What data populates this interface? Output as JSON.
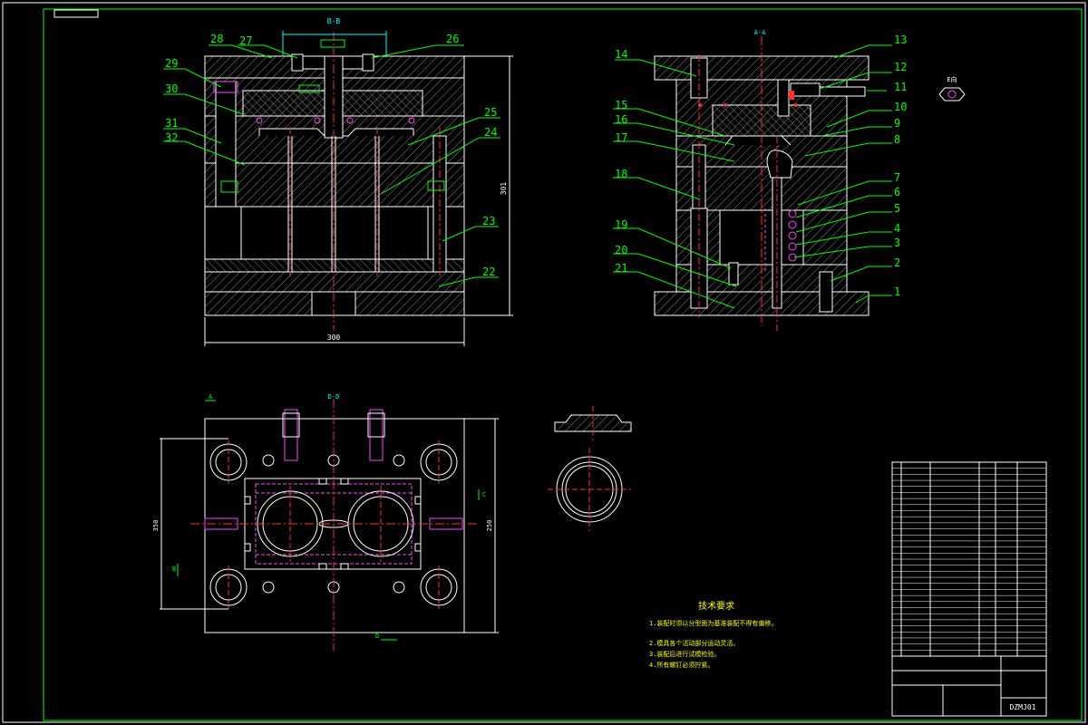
{
  "views": {
    "front_section_label": "B-B",
    "side_section_label": "A-A",
    "top_section_label": "D-D",
    "detail_label": "E向"
  },
  "part_numbers": {
    "left": [
      "28",
      "27",
      "26",
      "29",
      "30",
      "31",
      "32",
      "25",
      "24",
      "23",
      "22"
    ],
    "right": [
      "14",
      "13",
      "12",
      "11",
      "10",
      "9",
      "15",
      "16",
      "17",
      "8",
      "18",
      "7",
      "6",
      "5",
      "4",
      "3",
      "19",
      "20",
      "21",
      "2",
      "1"
    ]
  },
  "dimensions": {
    "front_width": "300",
    "front_height": "301",
    "top_height_left": "350",
    "top_height_right": "250",
    "bottom_width": "300"
  },
  "section_markers": {
    "a": "A",
    "b": "B",
    "c": "C",
    "d": "D"
  },
  "technical_requirements": {
    "title": "技术要求",
    "items": [
      "1.装配时须以分型面为基准装配不得有偏移。",
      "2.模具各个活动部分运动灵活。",
      "3.装配后进行试模检验。",
      "4.所有螺钉必须拧紧。"
    ]
  },
  "title_block": {
    "drawing_no": "DZMJ01"
  },
  "colors": {
    "outline": "#ffffff",
    "hatch": "#9a9a9a",
    "leader": "#00ff00",
    "center": "#ff3030",
    "magenta": "#ff44ff",
    "cyan": "#00ffff",
    "yellow": "#ffff00",
    "border": "#00ff00"
  }
}
